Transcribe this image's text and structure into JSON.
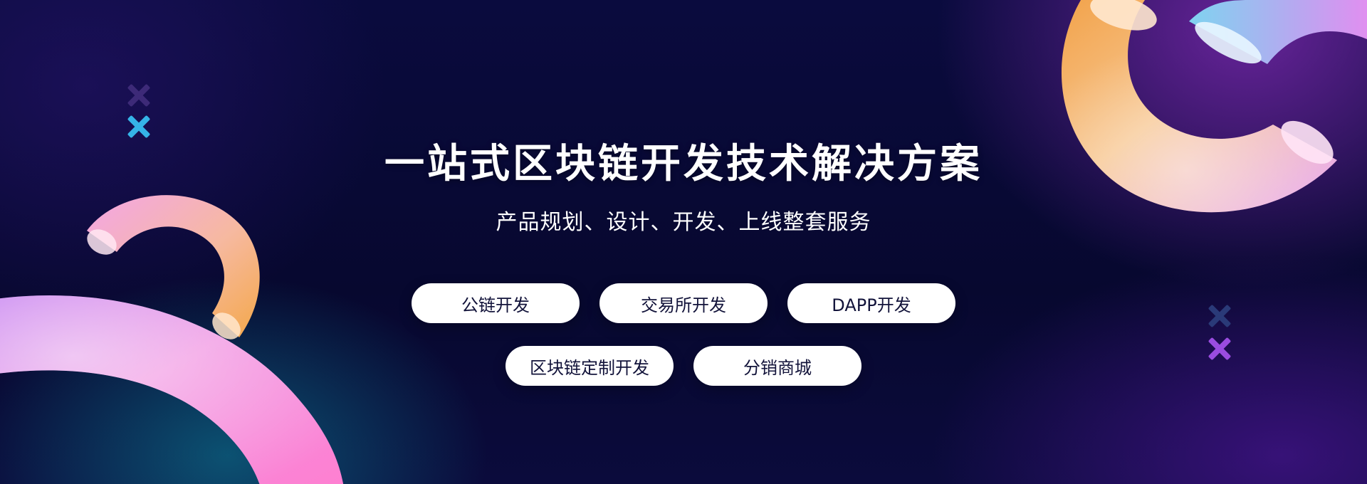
{
  "banner": {
    "title": "一站式区块链开发技术解决方案",
    "subtitle": "产品规划、设计、开发、上线整套服务"
  },
  "services": {
    "row1": [
      {
        "label": "公链开发"
      },
      {
        "label": "交易所开发"
      },
      {
        "label": "DAPP开发"
      }
    ],
    "row2": [
      {
        "label": "区块链定制开发"
      },
      {
        "label": "分销商城"
      }
    ]
  },
  "decorations": [
    {
      "icon": "torus-ring-icon",
      "colors": [
        "#f7b35a",
        "#e9a3ff"
      ]
    },
    {
      "icon": "cross-mark-icon",
      "colors": [
        "#3a2a7a",
        "#2fb0e8",
        "#9a4ce0"
      ]
    }
  ]
}
